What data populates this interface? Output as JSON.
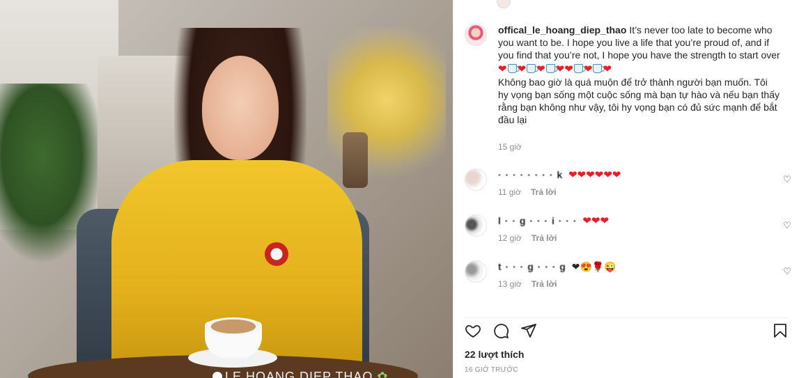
{
  "post": {
    "author": "offical_le_hoang_diep_thao",
    "caption_en": "It’s never too late to become who you want to be. I hope you live a life that you’re proud of, and if you find that you’re not, I hope you have the strength to start over",
    "caption_emoji": [
      "heart",
      "mug",
      "heart",
      "mug",
      "heart",
      "mug",
      "heart",
      "heart",
      "mug",
      "heart",
      "mug",
      "heart"
    ],
    "caption_vi": "Không bao giờ là quá muộn để trở thành người bạn muốn. Tôi hy vọng bạn sống một cuộc sống mà bạn tự hào và nếu bạn thấy rằng bạn không như vậy, tôi hy vọng bạn có đủ sức mạnh để bắt đầu lại",
    "caption_time": "15 giờ",
    "watermark": "LE HOANG DIEP THAO",
    "likes": "22 lượt thích",
    "time_ago": "16 GIỜ TRƯỚC"
  },
  "comments": [
    {
      "username": "· · · · · · · · k",
      "text": "❤❤❤❤❤❤",
      "time": "11 giờ",
      "reply": "Trả lời"
    },
    {
      "username": "l · · g · · · i · · ·",
      "text": "❤❤❤",
      "time": "12 giờ",
      "reply": "Trả lời"
    },
    {
      "username": "t · · · g · · · g",
      "text": "❤😍🌹😜",
      "time": "13 giờ",
      "reply": "Trả lời"
    }
  ],
  "icons": {
    "like": "heart-outline-icon",
    "comment": "comment-bubble-icon",
    "share": "paper-plane-icon",
    "save": "bookmark-icon"
  },
  "colors": {
    "heart": "#ed1c24",
    "muted": "#8e8e8e",
    "text": "#262626"
  }
}
